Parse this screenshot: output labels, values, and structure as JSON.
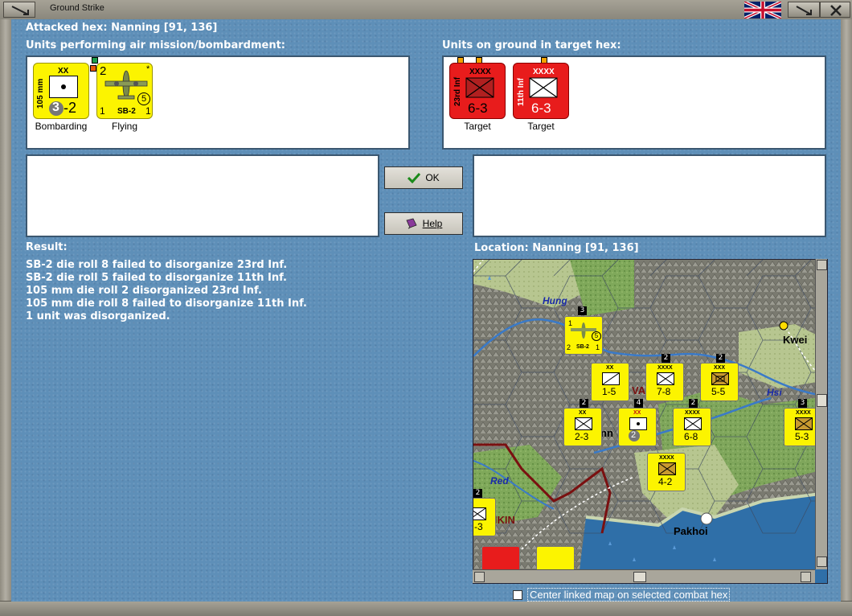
{
  "window": {
    "title": "Ground Strike"
  },
  "header": {
    "attacked_hex": "Attacked hex: Nanning  [91, 136]"
  },
  "air_units": {
    "label": "Units performing air mission/bombardment:",
    "items": [
      {
        "side_name": "105 mm",
        "size": "XX",
        "stat_left": "3",
        "stat_right": "-2",
        "caption": "Bombarding"
      },
      {
        "top_left": "2",
        "model": "SB-2",
        "bottom_left": "1",
        "bottom_right": "1",
        "circle_val": "5",
        "star": "*",
        "caption": "Flying"
      }
    ]
  },
  "ground_units": {
    "label": "Units on ground in target hex:",
    "items": [
      {
        "side_name": "23rd Inf",
        "size": "XXXX",
        "strength": "6-3",
        "caption": "Target"
      },
      {
        "side_name": "11th Inf",
        "size": "XXXX",
        "strength": "6-3",
        "caption": "Target"
      }
    ]
  },
  "buttons": {
    "ok": "OK",
    "help": "Help"
  },
  "result": {
    "label": "Result:",
    "lines": [
      "SB-2 die roll 8 failed to disorganize 23rd Inf.",
      "SB-2 die roll 5 failed to disorganize 11th Inf.",
      "105 mm die roll 2 disorganized 23rd Inf.",
      "105 mm die roll 8 failed to disorganize 11th Inf.",
      "1 unit was disorganized."
    ]
  },
  "location": {
    "label": "Location:  Nanning  [91, 136]"
  },
  "map": {
    "rivers": [
      "Hung",
      "Hsi",
      "Red"
    ],
    "places": [
      "Kwei",
      "Pakhoi",
      "ONKIN",
      "nn",
      "VA"
    ],
    "counters": [
      {
        "strength": "1-5",
        "size": "XX",
        "stack": ""
      },
      {
        "strength": "7-8",
        "size": "XXXX",
        "stack": "2"
      },
      {
        "strength": "5-5",
        "size": "XXX",
        "stack": "2"
      },
      {
        "strength": "2-3",
        "size": "XX",
        "stack": "2"
      },
      {
        "strength": "2",
        "size": "XX",
        "stack": "4"
      },
      {
        "strength": "6-8",
        "size": "XXXX",
        "stack": "2"
      },
      {
        "strength": "5-3",
        "size": "XXXX",
        "stack": "3"
      },
      {
        "strength": "4-2",
        "size": "XXXX",
        "stack": ""
      },
      {
        "strength": "-3",
        "size": "",
        "stack": "2"
      }
    ],
    "sb2": {
      "model": "SB-2",
      "top": "1",
      "bl": "2",
      "br": "1",
      "circle": "5",
      "stack": "3"
    }
  },
  "options": {
    "center_map": "Center linked map on selected combat hex"
  },
  "colors": {
    "unit_yellow": "#fcf400",
    "unit_red": "#e81c1c",
    "panel_bg": "#5e8fb8"
  }
}
